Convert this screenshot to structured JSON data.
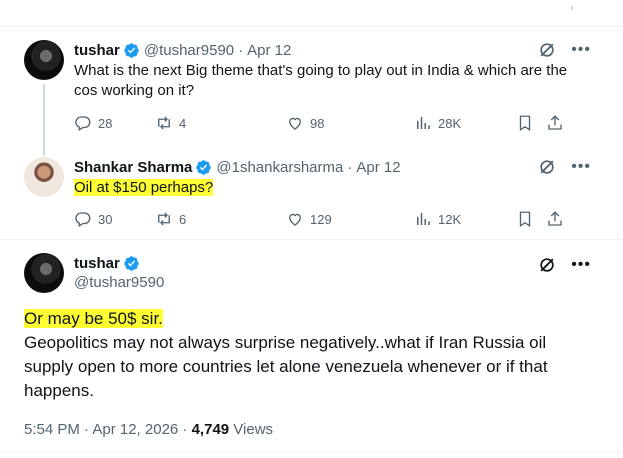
{
  "tweets": [
    {
      "name": "tushar",
      "handle": "@tushar9590",
      "date": "Apr 12",
      "text": "What is the next Big theme that's going to play out in India & which are the cos working on it?",
      "replies": "28",
      "retweets": "4",
      "likes": "98",
      "views": "28K"
    },
    {
      "name": "Shankar Sharma",
      "handle": "@1shankarsharma",
      "date": "Apr 12",
      "text": "Oil at  $150 perhaps?",
      "replies": "30",
      "retweets": "6",
      "likes": "129",
      "views": "12K"
    }
  ],
  "main": {
    "name": "tushar",
    "handle": "@tushar9590",
    "line1": "Or may be 50$ sir.",
    "body": "Geopolitics may not always surprise negatively..what if Iran Russia oil supply open to more countries let alone venezuela whenever or if that happens.",
    "timestamp": "5:54 PM · Apr 12, 2026 · ",
    "views_count": "4,749",
    "views_label": " Views"
  },
  "colors": {
    "highlight": "#ffff33",
    "verified": "#1d9bf0",
    "muted": "#536471"
  },
  "icons": [
    "verified-badge-icon",
    "grok-icon",
    "more-icon",
    "reply-icon",
    "retweet-icon",
    "like-icon",
    "views-icon",
    "bookmark-icon",
    "share-icon"
  ]
}
